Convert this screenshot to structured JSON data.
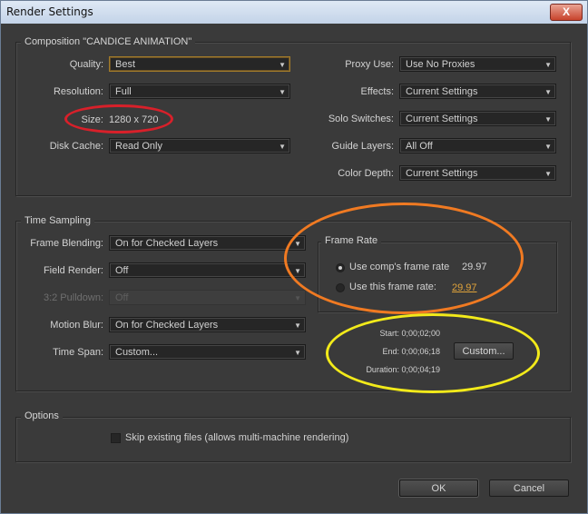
{
  "window": {
    "title": "Render Settings",
    "close_glyph": "X"
  },
  "composition": {
    "legend": "Composition \"CANDICE ANIMATION\"",
    "quality": {
      "label": "Quality:",
      "value": "Best"
    },
    "resolution": {
      "label": "Resolution:",
      "value": "Full"
    },
    "size": {
      "label": "Size:",
      "value": "1280 x 720"
    },
    "disk_cache": {
      "label": "Disk Cache:",
      "value": "Read Only"
    },
    "proxy_use": {
      "label": "Proxy Use:",
      "value": "Use No Proxies"
    },
    "effects": {
      "label": "Effects:",
      "value": "Current Settings"
    },
    "solo_switches": {
      "label": "Solo Switches:",
      "value": "Current Settings"
    },
    "guide_layers": {
      "label": "Guide Layers:",
      "value": "All Off"
    },
    "color_depth": {
      "label": "Color Depth:",
      "value": "Current Settings"
    }
  },
  "time_sampling": {
    "legend": "Time Sampling",
    "frame_blending": {
      "label": "Frame Blending:",
      "value": "On for Checked Layers"
    },
    "field_render": {
      "label": "Field Render:",
      "value": "Off"
    },
    "pulldown": {
      "label": "3:2 Pulldown:",
      "value": "Off"
    },
    "motion_blur": {
      "label": "Motion Blur:",
      "value": "On for Checked Layers"
    },
    "time_span": {
      "label": "Time Span:",
      "value": "Custom..."
    },
    "frame_rate": {
      "legend": "Frame Rate",
      "use_comp_label": "Use comp's frame rate",
      "use_comp_value": "29.97",
      "use_this_label": "Use this frame rate:",
      "use_this_value": "29.97"
    },
    "start": "Start: 0;00;02;00",
    "end": "End: 0;00;06;18",
    "duration": "Duration: 0;00;04;19",
    "custom_button": "Custom..."
  },
  "options": {
    "legend": "Options",
    "skip_existing": "Skip existing files (allows multi-machine rendering)"
  },
  "buttons": {
    "ok": "OK",
    "cancel": "Cancel"
  },
  "annotations": {
    "red": "#d8202a",
    "orange": "#f07a22",
    "yellow": "#f2ea1a"
  },
  "icons": {
    "dropdown": "▼"
  }
}
